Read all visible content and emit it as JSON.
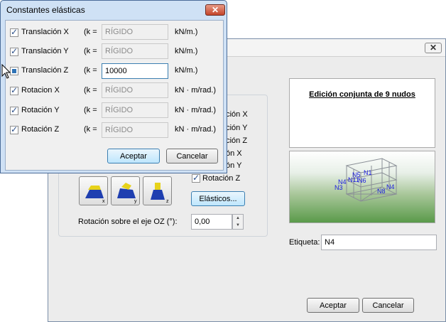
{
  "background_window": {
    "group_checks": [
      {
        "label": "ación X",
        "checked": false
      },
      {
        "label": "ación Y",
        "checked": false
      },
      {
        "label": "ación Z",
        "checked": false
      },
      {
        "label": "ón X",
        "checked": false
      },
      {
        "label": "ón Y",
        "checked": false
      },
      {
        "label": "Rotación Z",
        "checked": true
      }
    ],
    "elasticos_button": "Elásticos...",
    "rotation_label": "Rotación sobre el eje OZ (°):",
    "rotation_value": "0,00",
    "preview_title": "Edición conjunta de 9 nudos",
    "nodes": [
      "N5",
      "N1",
      "N4",
      "N11",
      "N6",
      "N8",
      "N3",
      "N4"
    ],
    "etiqueta_label": "Etiqueta:",
    "etiqueta_value": "N4",
    "accept": "Aceptar",
    "cancel": "Cancelar",
    "icon_axis_labels": [
      "x",
      "y",
      "z"
    ]
  },
  "dialog": {
    "title": "Constantes elásticas",
    "rows": [
      {
        "label": "Translación X",
        "k": "(k =",
        "value": "RÍGIDO",
        "unit": "kN/m.)",
        "checked": true,
        "editable": false
      },
      {
        "label": "Translación Y",
        "k": "(k =",
        "value": "RÍGIDO",
        "unit": "kN/m.)",
        "checked": true,
        "editable": false
      },
      {
        "label": "Translación Z",
        "k": "(k =",
        "value": "10000",
        "unit": "kN/m.)",
        "checked": false,
        "editable": true
      },
      {
        "label": "Rotacion X",
        "k": "(k =",
        "value": "RÍGIDO",
        "unit": "kN · m/rad.)",
        "checked": true,
        "editable": false
      },
      {
        "label": "Rotación Y",
        "k": "(k =",
        "value": "RÍGIDO",
        "unit": "kN · m/rad.)",
        "checked": true,
        "editable": false
      },
      {
        "label": "Rotación Z",
        "k": "(k =",
        "value": "RÍGIDO",
        "unit": "kN · m/rad.)",
        "checked": true,
        "editable": false
      }
    ],
    "accept": "Aceptar",
    "cancel": "Cancelar"
  }
}
